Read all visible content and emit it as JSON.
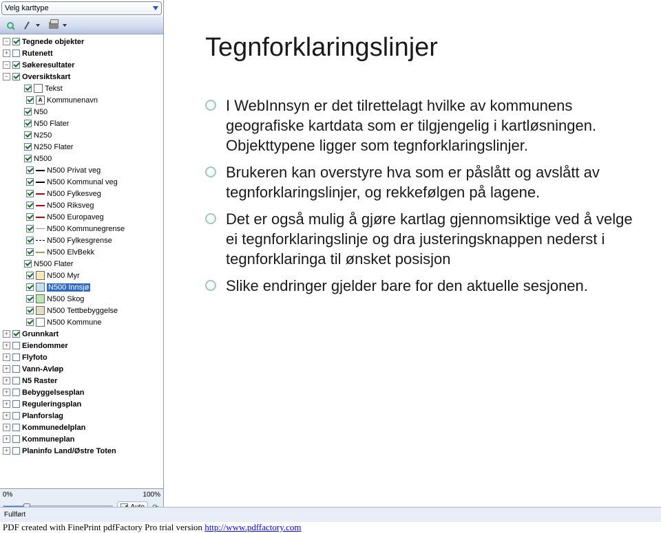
{
  "header": {
    "mapType": "Velg karttype"
  },
  "toolbar": {
    "search": "Søk",
    "pen": "Tegn",
    "print": "Skriv ut"
  },
  "tree": {
    "groups": [
      {
        "name": "Tegnede objekter",
        "expandable": true,
        "expanded": false,
        "checked": true,
        "bold": true,
        "pm": "−",
        "level": 0
      },
      {
        "name": "Rutenett",
        "expandable": true,
        "expanded": false,
        "checked": false,
        "bold": true,
        "pm": "+",
        "level": 0
      },
      {
        "name": "Søkeresultater",
        "expandable": true,
        "expanded": false,
        "checked": true,
        "bold": true,
        "pm": "−",
        "level": 0
      },
      {
        "name": "Oversiktskart",
        "expandable": true,
        "expanded": true,
        "checked": true,
        "bold": true,
        "pm": "−",
        "level": 0
      }
    ],
    "layers": [
      {
        "name": "Tekst",
        "checked": true,
        "icon": "box",
        "level": 1
      },
      {
        "name": "Kommunenavn",
        "checked": true,
        "icon": "A",
        "level": 2
      },
      {
        "name": "N50",
        "checked": true,
        "icon": "none",
        "level": 1
      },
      {
        "name": "N50 Flater",
        "checked": true,
        "icon": "none",
        "level": 1
      },
      {
        "name": "N250",
        "checked": true,
        "icon": "none",
        "level": 1
      },
      {
        "name": "N250 Flater",
        "checked": true,
        "icon": "none",
        "level": 1
      },
      {
        "name": "N500",
        "checked": true,
        "icon": "none",
        "level": 1
      },
      {
        "name": "N500 Privat veg",
        "checked": true,
        "icon": "line",
        "level": 2
      },
      {
        "name": "N500 Kommunal veg",
        "checked": true,
        "icon": "line",
        "level": 2
      },
      {
        "name": "N500 Fylkesveg",
        "checked": true,
        "icon": "line-red",
        "level": 2
      },
      {
        "name": "N500 Riksveg",
        "checked": true,
        "icon": "line-red",
        "level": 2
      },
      {
        "name": "N500 Europaveg",
        "checked": true,
        "icon": "line-red",
        "level": 2
      },
      {
        "name": "N500 Kommunegrense",
        "checked": true,
        "icon": "line-grey",
        "level": 2
      },
      {
        "name": "N500 Fylkesgrense",
        "checked": true,
        "icon": "line-dash",
        "level": 2
      },
      {
        "name": "N500 ElvBekk",
        "checked": true,
        "icon": "line-green",
        "level": 2
      },
      {
        "name": "N500 Flater",
        "checked": true,
        "icon": "none",
        "level": 1
      },
      {
        "name": "N500 Myr",
        "checked": true,
        "icon": "fill-a",
        "level": 2
      },
      {
        "name": "N500 Innsjø",
        "checked": true,
        "icon": "lblue",
        "level": 2,
        "selected": true
      },
      {
        "name": "N500 Skog",
        "checked": true,
        "icon": "green",
        "level": 2
      },
      {
        "name": "N500 Tettbebyggelse",
        "checked": true,
        "icon": "fill-b",
        "level": 2
      },
      {
        "name": "N500 Kommune",
        "checked": true,
        "icon": "white",
        "level": 2
      }
    ],
    "bottomGroups": [
      {
        "name": "Grunnkart",
        "checked": true,
        "pm": "+"
      },
      {
        "name": "Eiendommer",
        "checked": false,
        "pm": "+"
      },
      {
        "name": "Flyfoto",
        "checked": false,
        "pm": "+"
      },
      {
        "name": "Vann-Avløp",
        "checked": false,
        "pm": "+"
      },
      {
        "name": "N5 Raster",
        "checked": false,
        "pm": "+"
      },
      {
        "name": "Bebyggelsesplan",
        "checked": false,
        "pm": "+"
      },
      {
        "name": "Reguleringsplan",
        "checked": false,
        "pm": "+"
      },
      {
        "name": "Planforslag",
        "checked": false,
        "pm": "+"
      },
      {
        "name": "Kommunedelplan",
        "checked": false,
        "pm": "+"
      },
      {
        "name": "Kommuneplan",
        "checked": false,
        "pm": "+"
      },
      {
        "name": "Planinfo Land/Østre Toten",
        "checked": false,
        "pm": "+"
      }
    ]
  },
  "opacity": {
    "min": "0%",
    "max": "100%",
    "mode": "Auto"
  },
  "status": {
    "text": "Fullført"
  },
  "content": {
    "title": "Tegnforklaringslinjer",
    "bullets": [
      "I WebInnsyn er det tilrettelagt hvilke av kommunens geografiske kartdata som er tilgjengelig i kartløsningen. Objekttypene ligger som tegnforklaringslinjer.",
      "Brukeren kan overstyre hva som er påslått og avslått av tegnforklaringslinjer, og rekkefølgen på lagene.",
      "Det er også mulig å gjøre kartlag gjennomsiktige ved å velge ei tegnforklaringslinje og dra justeringsknappen nederst i tegnforklaringa til ønsket posisjon",
      "Slike endringer gjelder bare for den aktuelle sesjonen."
    ]
  },
  "footer": {
    "text": "PDF created with FinePrint pdfFactory Pro trial version ",
    "linkText": "http://www.pdffactory.com"
  }
}
